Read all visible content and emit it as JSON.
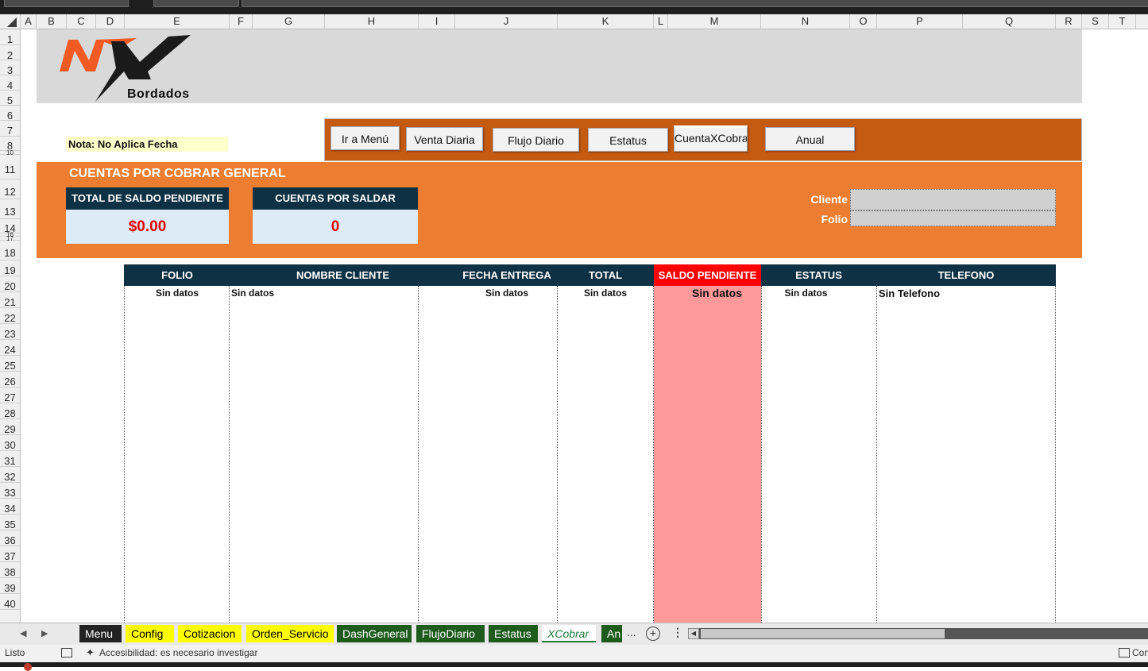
{
  "columns": [
    "A",
    "B",
    "C",
    "D",
    "E",
    "F",
    "G",
    "H",
    "I",
    "J",
    "K",
    "L",
    "M",
    "N",
    "O",
    "P",
    "Q",
    "R",
    "S",
    "T"
  ],
  "rows": [
    "1",
    "2",
    "3",
    "4",
    "5",
    "6",
    "7",
    "8",
    "10",
    "11",
    "12",
    "13",
    "14",
    "16",
    "17",
    "18",
    "19",
    "20",
    "21",
    "22",
    "23",
    "24",
    "25",
    "26",
    "27",
    "28",
    "29",
    "30",
    "31",
    "32",
    "33",
    "34",
    "35",
    "36",
    "37",
    "38",
    "39",
    "40"
  ],
  "logo": {
    "brand": "Bordados"
  },
  "note": "Nota: No Aplica Fecha",
  "nav": {
    "buttons": [
      "Ir a Menú",
      "Venta Diaria",
      "Flujo Diario",
      "Estatus",
      "CuentaXCobra",
      "Anual"
    ]
  },
  "banner": {
    "title": "CUENTAS POR COBRAR GENERAL",
    "kpi1": {
      "label": "TOTAL DE SALDO PENDIENTE",
      "value": "$0.00"
    },
    "kpi2": {
      "label": "CUENTAS POR SALDAR",
      "value": "0"
    },
    "filters": {
      "cliente_label": "Cliente",
      "folio_label": "Folio",
      "cliente_value": "",
      "folio_value": ""
    }
  },
  "table": {
    "headers": [
      "FOLIO",
      "NOMBRE CLIENTE",
      "FECHA ENTREGA",
      "TOTAL",
      "SALDO PENDIENTE",
      "ESTATUS",
      "TELEFONO"
    ],
    "row": [
      "Sin datos",
      "Sin datos",
      "Sin datos",
      "Sin datos",
      "Sin datos",
      "Sin datos",
      "Sin Telefono"
    ]
  },
  "sheet_tabs": [
    {
      "label": "Menu",
      "bg": "#222222",
      "fg": "#ffffff"
    },
    {
      "label": "Config",
      "bg": "#ffff00",
      "fg": "#000000"
    },
    {
      "label": "Cotizacion",
      "bg": "#ffff00",
      "fg": "#000000"
    },
    {
      "label": "Orden_Servicio",
      "bg": "#ffff00",
      "fg": "#000000"
    },
    {
      "label": "DashGeneral",
      "bg": "#1e5c1e",
      "fg": "#ffffff"
    },
    {
      "label": "FlujoDiario",
      "bg": "#1e5c1e",
      "fg": "#ffffff"
    },
    {
      "label": "Estatus",
      "bg": "#1e5c1e",
      "fg": "#ffffff"
    },
    {
      "label": "XCobrar",
      "bg": "#ffffff",
      "fg": "#1e7a3c",
      "active": true
    },
    {
      "label": "An",
      "bg": "#1e5c1e",
      "fg": "#ffffff"
    }
  ],
  "tabbar": {
    "more": "..."
  },
  "status": {
    "ready": "Listo",
    "accessibility": "Accesibilidad: es necesario investigar",
    "right": "Con"
  },
  "colors": {
    "logo_band": "#d9d9d9",
    "nav_bar": "#c55a11",
    "banner": "#ed7d31",
    "header_navy": "#0f3144",
    "highlight_red": "#ff0000",
    "saldo_fill": "#ff9999",
    "kpi_fill": "#ddebf7",
    "note_fill": "#ffffcc"
  }
}
